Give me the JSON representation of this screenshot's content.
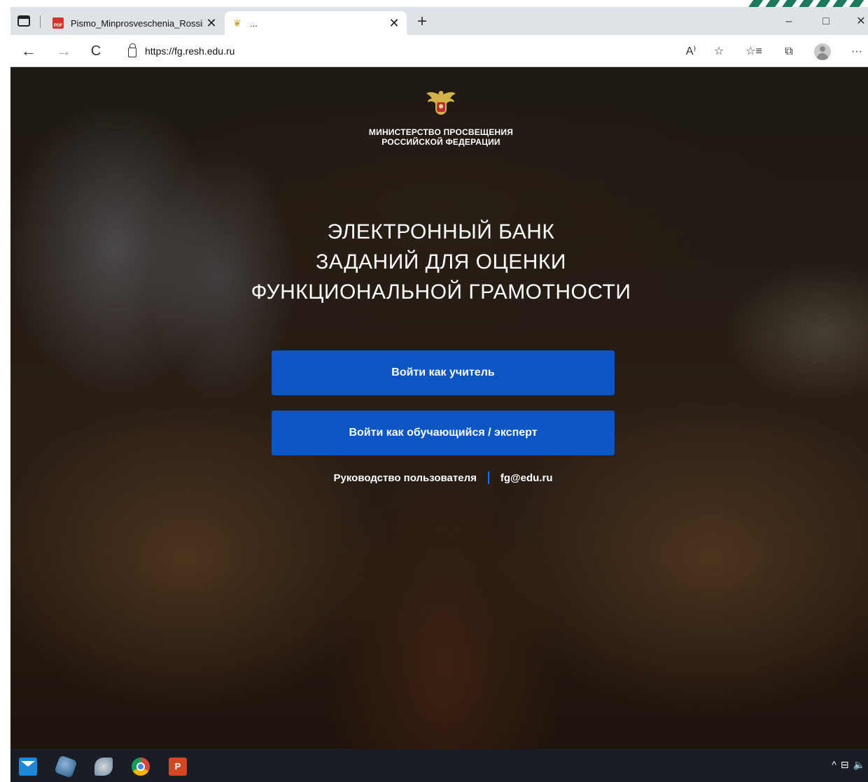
{
  "browser": {
    "tabs": [
      {
        "label": "Pismo_Minprosveschenia_Rossii_",
        "favicon": "pdf-icon",
        "active": false
      },
      {
        "label": "...",
        "favicon": "eagle-emblem-icon",
        "active": true
      }
    ],
    "new_tab_symbol": "+",
    "window_controls": {
      "minimize": "–",
      "maximize": "□",
      "close": "✕"
    },
    "nav": {
      "back": "←",
      "forward": "→",
      "refresh": "C"
    },
    "url": "https://fg.resh.edu.ru",
    "toolbar_icons": [
      "read-aloud-icon",
      "add-favorite-icon",
      "favorites-icon",
      "collections-icon",
      "profile-icon",
      "more-icon"
    ],
    "toolbar_symbols": {
      "read_aloud": "A⁾",
      "add_favorite": "☆",
      "favorites": "☆≡",
      "collections": "⧉",
      "more": "···"
    }
  },
  "page": {
    "ministry_lines": [
      "МИНИСТЕРСТВО ПРОСВЕЩЕНИЯ",
      "РОССИЙСКОЙ ФЕДЕРАЦИИ"
    ],
    "headline_lines": [
      "ЭЛЕКТРОННЫЙ БАНК",
      "ЗАДАНИЙ ДЛЯ ОЦЕНКИ",
      "ФУНКЦИОНАЛЬНОЙ ГРАМОТНОСТИ"
    ],
    "buttons": {
      "teacher": "Войти как учитель",
      "student": "Войти как обучающийся / эксперт"
    },
    "links": {
      "manual": "Руководство пользователя",
      "email": "fg@edu.ru"
    },
    "colors": {
      "button": "#0b56c2",
      "separator": "#1e6ee8"
    }
  },
  "taskbar": {
    "apps": [
      "mail-icon",
      "app-icon",
      "app-icon",
      "chrome-icon",
      "powerpoint-icon"
    ],
    "ppt_glyph": "P",
    "tray": {
      "chevron": "^",
      "network": "⊟",
      "volume": "🔈"
    }
  }
}
